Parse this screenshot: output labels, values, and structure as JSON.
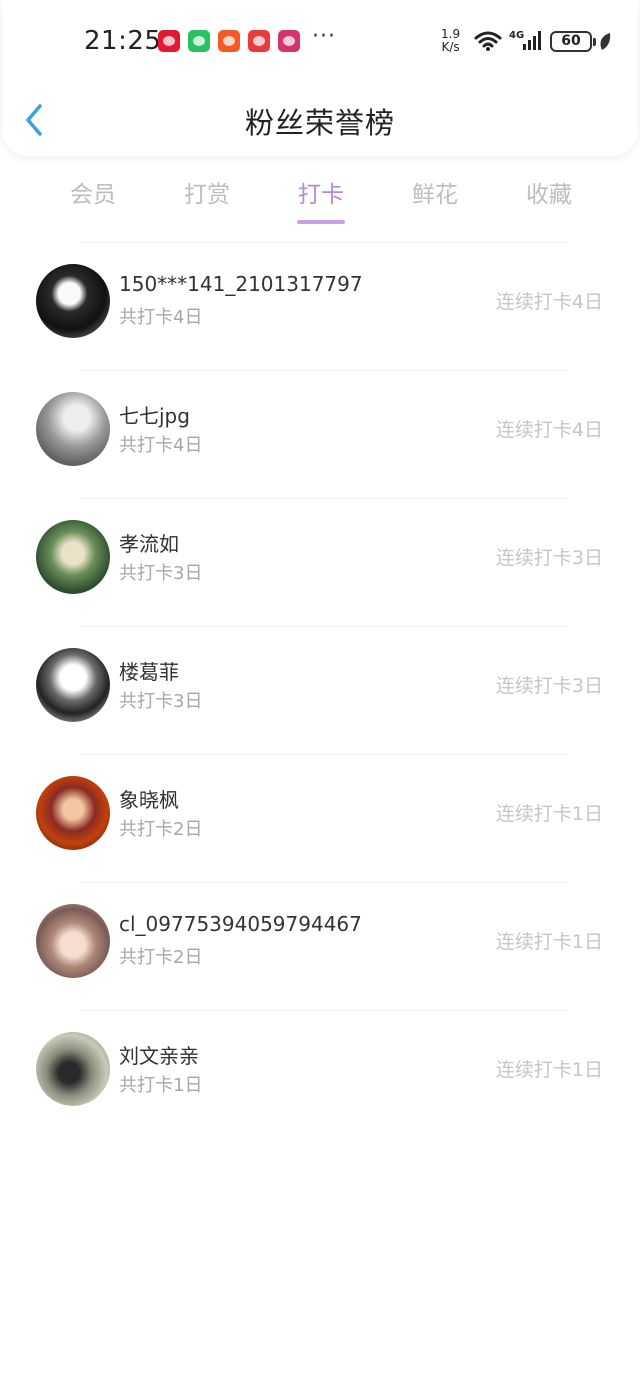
{
  "status_bar": {
    "time": "21:25",
    "more": "···",
    "net_speed_value": "1.9",
    "net_speed_unit": "K/s",
    "network": "4G",
    "battery": "60",
    "app_icons": [
      "tmall-icon",
      "wechat-icon",
      "taobao-icon",
      "jd-icon",
      "huawei-icon"
    ]
  },
  "header": {
    "title": "粉丝荣誉榜"
  },
  "tabs": [
    {
      "label": "会员",
      "active": false
    },
    {
      "label": "打赏",
      "active": false
    },
    {
      "label": "打卡",
      "active": true
    },
    {
      "label": "鲜花",
      "active": false
    },
    {
      "label": "收藏",
      "active": false
    }
  ],
  "colors": {
    "accent": "#b58ad8",
    "back_arrow": "#3aa0e6"
  },
  "list": [
    {
      "name": "150***141_2101317797",
      "total": "共打卡4日",
      "streak": "连续打卡4日"
    },
    {
      "name": "七七jpg",
      "total": "共打卡4日",
      "streak": "连续打卡4日"
    },
    {
      "name": "孝流如",
      "total": "共打卡3日",
      "streak": "连续打卡3日"
    },
    {
      "name": "楼葛菲",
      "total": "共打卡3日",
      "streak": "连续打卡3日"
    },
    {
      "name": "象晓枫",
      "total": "共打卡2日",
      "streak": "连续打卡1日"
    },
    {
      "name": "cl_09775394059794467",
      "total": "共打卡2日",
      "streak": "连续打卡1日"
    },
    {
      "name": "刘文亲亲",
      "total": "共打卡1日",
      "streak": "连续打卡1日"
    }
  ]
}
